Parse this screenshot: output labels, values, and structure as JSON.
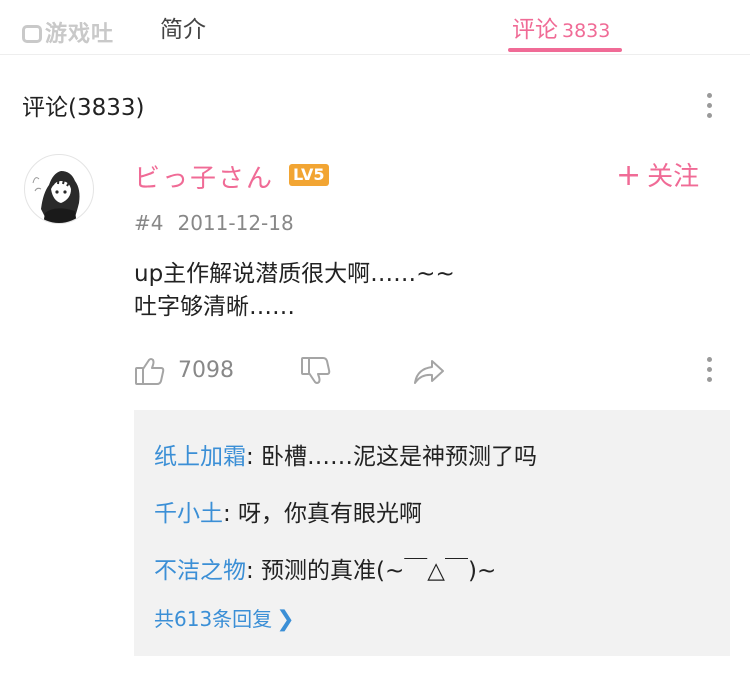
{
  "watermark": {
    "text": "游戏吐"
  },
  "tabs": [
    {
      "label": "简介"
    },
    {
      "label": "评论",
      "count": "3833"
    }
  ],
  "section": {
    "title": "评论(3833)"
  },
  "comment": {
    "username": "ビっ子さん",
    "level": "LV5",
    "follow_label": "关注",
    "floor": "#4",
    "date": "2011-12-18",
    "lines": [
      "up主作解说潜质很大啊……~~",
      "吐字够清晰……"
    ],
    "likes": "7098"
  },
  "replies": [
    {
      "name": "纸上加霜",
      "text": ": 卧槽……泥这是神预测了吗"
    },
    {
      "name": "千小土",
      "text": ": 呀，你真有眼光啊"
    },
    {
      "name": "不洁之物",
      "text": ": 预测的真准(~￣△￣)~"
    }
  ],
  "reply_more": {
    "label": "共613条回复"
  },
  "icons": {
    "like": "thumbs-up-icon",
    "dislike": "thumbs-down-icon",
    "share": "share-icon",
    "more": "more-vertical-icon"
  },
  "colors": {
    "accent": "#f06b96",
    "reply_name": "#3b8fd6",
    "level_badge": "#f2a533",
    "muted": "#888888",
    "reply_bg": "#f2f2f2"
  }
}
